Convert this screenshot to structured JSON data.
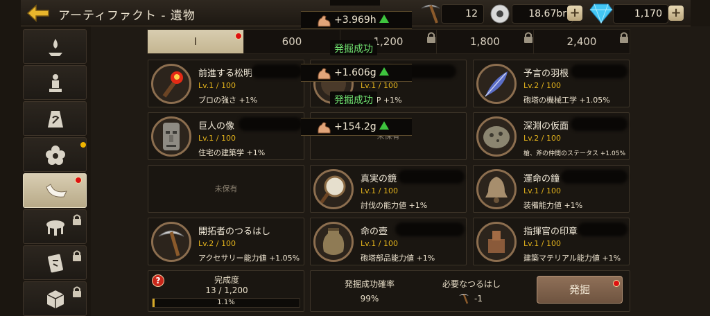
{
  "header": {
    "title": "アーティファクト - 遺物",
    "pickaxes": "12",
    "gears": "18.67br",
    "gems": "1,170"
  },
  "tabs": [
    {
      "label": "I"
    },
    {
      "label": "600"
    },
    {
      "label": "1,200"
    },
    {
      "label": "1,800"
    },
    {
      "label": "2,400"
    }
  ],
  "floats": {
    "boost1": "+3.969h",
    "boost2": "+1.606g",
    "boost3": "+154.2g",
    "success1": "発掘成功",
    "success2": "発掘成功"
  },
  "cards": [
    {
      "name": "前進する松明",
      "level": "Lv.1 / 100",
      "effect_label": "ブロの強さ",
      "effect_value": "+1%"
    },
    {
      "name": "",
      "level": "Lv.1 / 100",
      "effect_label": "の HP",
      "effect_value": "+1%"
    },
    {
      "name": "予言の羽根",
      "level": "Lv.2 / 100",
      "effect_label": "砲塔の機械工学",
      "effect_value": "+1.05%"
    },
    {
      "name": "巨人の像",
      "level": "Lv.1 / 100",
      "effect_label": "住宅の建築学",
      "effect_value": "+1%"
    },
    {
      "empty": "未保有"
    },
    {
      "name": "深淵の仮面",
      "level": "Lv.2 / 100",
      "effect_label": "槍、斧の仲間のステータス",
      "effect_value": "+1.05%"
    },
    {
      "empty": "未保有"
    },
    {
      "name": "真実の鏡",
      "level": "Lv.1 / 100",
      "effect_label": "討伐の能力値",
      "effect_value": "+1%"
    },
    {
      "name": "運命の鐘",
      "level": "Lv.1 / 100",
      "effect_label": "装備能力値",
      "effect_value": "+1%"
    },
    {
      "name": "開拓者のつるはし",
      "level": "Lv.2 / 100",
      "effect_label": "アクセサリー能力値",
      "effect_value": "+1.05%"
    },
    {
      "name": "命の壺",
      "level": "Lv.1 / 100",
      "effect_label": "砲塔部品能力値",
      "effect_value": "+1%"
    },
    {
      "name": "指揮官の印章",
      "level": "Lv.1 / 100",
      "effect_label": "建築マテリアル能力値",
      "effect_value": "+1%"
    }
  ],
  "completion": {
    "label": "完成度",
    "count": "13 / 1,200",
    "percent_text": "1.1%",
    "fraction": 0.011,
    "help": "?"
  },
  "dig_info": {
    "rate_label": "発掘成功確率",
    "rate_value": "99%",
    "need_label": "必要なつるはし",
    "need_value": "-1"
  },
  "dig_button": {
    "label": "発掘"
  },
  "colors": {
    "accent": "#e2b21c",
    "success": "#6fe06f",
    "alert": "#d11111"
  }
}
